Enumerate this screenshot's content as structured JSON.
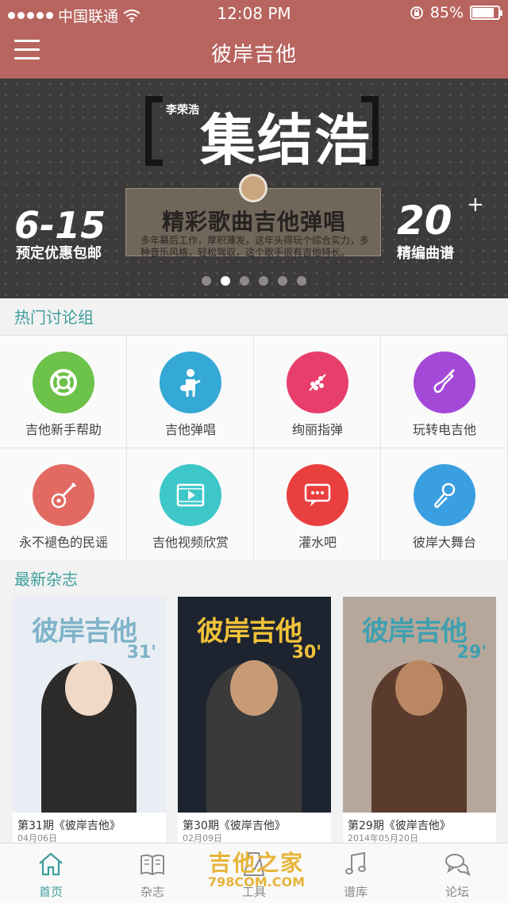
{
  "status_bar": {
    "carrier": "中国联通",
    "time": "12:08 PM",
    "battery": "85%",
    "battery_level": 0.85
  },
  "nav": {
    "title": "彼岸吉他",
    "menu_icon": "hamburger-menu-icon"
  },
  "banner": {
    "name": "李荣浩",
    "title": "集结浩",
    "subtitle": "精彩歌曲吉他弹唱",
    "description": "多年幕后工作，厚积薄发，这年头得玩个综合实力，多种音乐风格，轻松驾驭，这个歌手很有吉他特长。",
    "date": "6-15",
    "left_text": "预定优惠包邮",
    "count": "20",
    "count_plus": "+",
    "right_text": "精编曲谱",
    "pages": 6,
    "active_page": 1
  },
  "groups": {
    "heading": "热门讨论组",
    "items": [
      {
        "label": "吉他新手帮助",
        "icon": "lifebuoy-icon",
        "color": "#6cc24a"
      },
      {
        "label": "吉他弹唱",
        "icon": "guitar-player-icon",
        "color": "#35a9d6"
      },
      {
        "label": "绚丽指弹",
        "icon": "fingerstyle-hand-icon",
        "color": "#e83e6c"
      },
      {
        "label": "玩转电吉他",
        "icon": "electric-guitar-icon",
        "color": "#a448d8"
      },
      {
        "label": "永不褪色的民谣",
        "icon": "acoustic-guitar-icon",
        "color": "#e26a62"
      },
      {
        "label": "吉他视频欣赏",
        "icon": "video-play-icon",
        "color": "#3ec7c9"
      },
      {
        "label": "灌水吧",
        "icon": "chat-bubble-icon",
        "color": "#ea3f3f"
      },
      {
        "label": "彼岸大舞台",
        "icon": "microphone-icon",
        "color": "#3a9fe0"
      }
    ]
  },
  "magazines": {
    "heading": "最新杂志",
    "items": [
      {
        "caption": "第31期《彼岸吉他》",
        "date": "04月06日",
        "logo": "彼岸吉他",
        "issue": "31'",
        "cover_bg": "#e9eef4",
        "logo_color": "#7fb3c8",
        "figure_color": "#2d2a2a",
        "skin_color": "#f0d9c6"
      },
      {
        "caption": "第30期《彼岸吉他》",
        "date": "02月09日",
        "logo": "彼岸吉他",
        "issue": "30'",
        "cover_bg": "#1d2430",
        "logo_color": "#f0c23a",
        "figure_color": "#3a3a3a",
        "skin_color": "#c89b75"
      },
      {
        "caption": "第29期《彼岸吉他》",
        "date": "2014年05月20日",
        "logo": "彼岸吉他",
        "issue": "29'",
        "cover_bg": "#b7a79a",
        "logo_color": "#3ea0b0",
        "figure_color": "#5a3b2c",
        "skin_color": "#b98863"
      }
    ]
  },
  "tabs": [
    {
      "label": "首页",
      "icon": "home-icon",
      "active": true
    },
    {
      "label": "杂志",
      "icon": "book-icon",
      "active": false
    },
    {
      "label": "工具",
      "icon": "metronome-icon",
      "active": false
    },
    {
      "label": "谱库",
      "icon": "music-note-icon",
      "active": false
    },
    {
      "label": "论坛",
      "icon": "chat-icon",
      "active": false
    }
  ],
  "watermark": {
    "line1": "吉他之家",
    "line2": "798COM.COM"
  }
}
